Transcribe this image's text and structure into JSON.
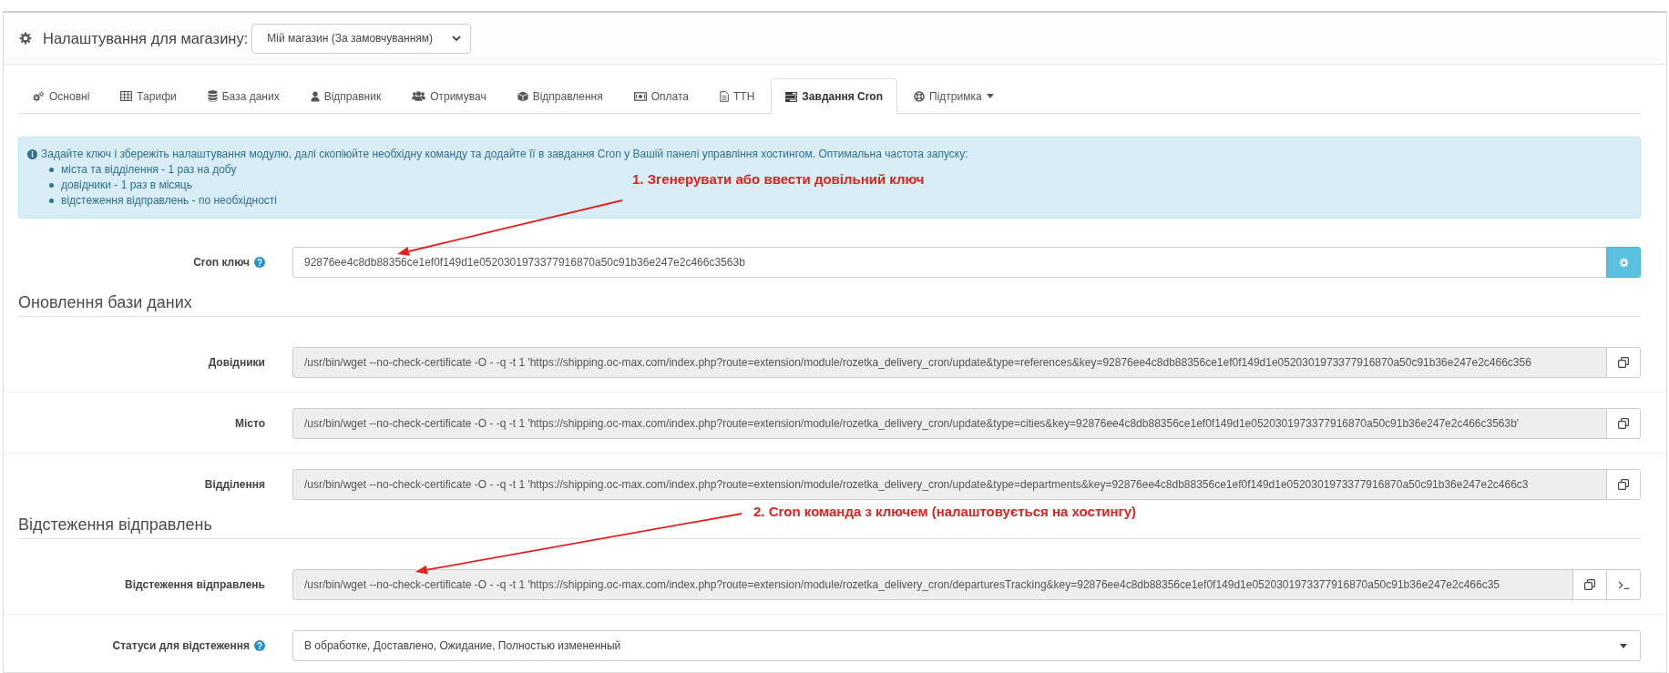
{
  "store_settings": {
    "label": "Налаштування для магазину:",
    "store": "Мій магазин (За замовчуванням)"
  },
  "tabs": [
    {
      "label": "Основні",
      "selected": false,
      "dropdown": false
    },
    {
      "label": "Тарифи",
      "selected": false,
      "dropdown": false
    },
    {
      "label": "База даних",
      "selected": false,
      "dropdown": false
    },
    {
      "label": "Відправник",
      "selected": false,
      "dropdown": false
    },
    {
      "label": "Отримувач",
      "selected": false,
      "dropdown": false
    },
    {
      "label": "Відправлення",
      "selected": false,
      "dropdown": false
    },
    {
      "label": "Оплата",
      "selected": false,
      "dropdown": false
    },
    {
      "label": "ТТН",
      "selected": false,
      "dropdown": false
    },
    {
      "label": "Завдання Cron",
      "selected": true,
      "dropdown": false
    },
    {
      "label": "Підтримка",
      "selected": false,
      "dropdown": true
    }
  ],
  "info": {
    "text": "Задайте ключ і збережіть налаштування модулю, далі скопіюйте необхідну команду та додайте її в завдання Cron у Вашій панелі управління хостингом. Оптимальна частота запуску:",
    "items": [
      "міста та відділення - 1 раз на добу",
      "довідники - 1 раз в місяць",
      "відстеження відправлень - по необхідності"
    ]
  },
  "cron_key": {
    "label": "Cron ключ",
    "help": true,
    "value": "92876ee4c8db88356ce1ef0f149d1e0520301973377916870a50c91b36e247e2c466c3563b"
  },
  "sections": [
    {
      "title": "Оновлення бази даних",
      "rows": [
        {
          "label": "Довідники",
          "value": "/usr/bin/wget --no-check-certificate -O - -q -t 1 'https://shipping.oc-max.com/index.php?route=extension/module/rozetka_delivery_cron/update&type=references&key=92876ee4c8db88356ce1ef0f149d1e0520301973377916870a50c91b36e247e2c466c356",
          "run_button": false
        },
        {
          "label": "Місто",
          "value": "/usr/bin/wget --no-check-certificate -O - -q -t 1 'https://shipping.oc-max.com/index.php?route=extension/module/rozetka_delivery_cron/update&type=cities&key=92876ee4c8db88356ce1ef0f149d1e0520301973377916870a50c91b36e247e2c466c3563b'",
          "run_button": false
        },
        {
          "label": "Відділення",
          "value": "/usr/bin/wget --no-check-certificate -O - -q -t 1 'https://shipping.oc-max.com/index.php?route=extension/module/rozetka_delivery_cron/update&type=departments&key=92876ee4c8db88356ce1ef0f149d1e0520301973377916870a50c91b36e247e2c466c3",
          "run_button": false
        }
      ]
    },
    {
      "title": "Відстеження відправлень",
      "rows": [
        {
          "label": "Відстеження відправлень",
          "value": "/usr/bin/wget --no-check-certificate -O - -q -t 1 'https://shipping.oc-max.com/index.php?route=extension/module/rozetka_delivery_cron/departuresTracking&key=92876ee4c8db88356ce1ef0f149d1e0520301973377916870a50c91b36e247e2c466c35",
          "run_button": true
        }
      ]
    }
  ],
  "status_filter": {
    "label": "Статуси для відстеження",
    "help": true,
    "value": "В обработке, Доставлено, Ожидание, Полностью измененный"
  },
  "annotations": [
    {
      "text": "1. Згенерувати або ввести довільний ключ"
    },
    {
      "text": "2. Cron команда з ключем (налаштовується на хостингу)"
    }
  ]
}
